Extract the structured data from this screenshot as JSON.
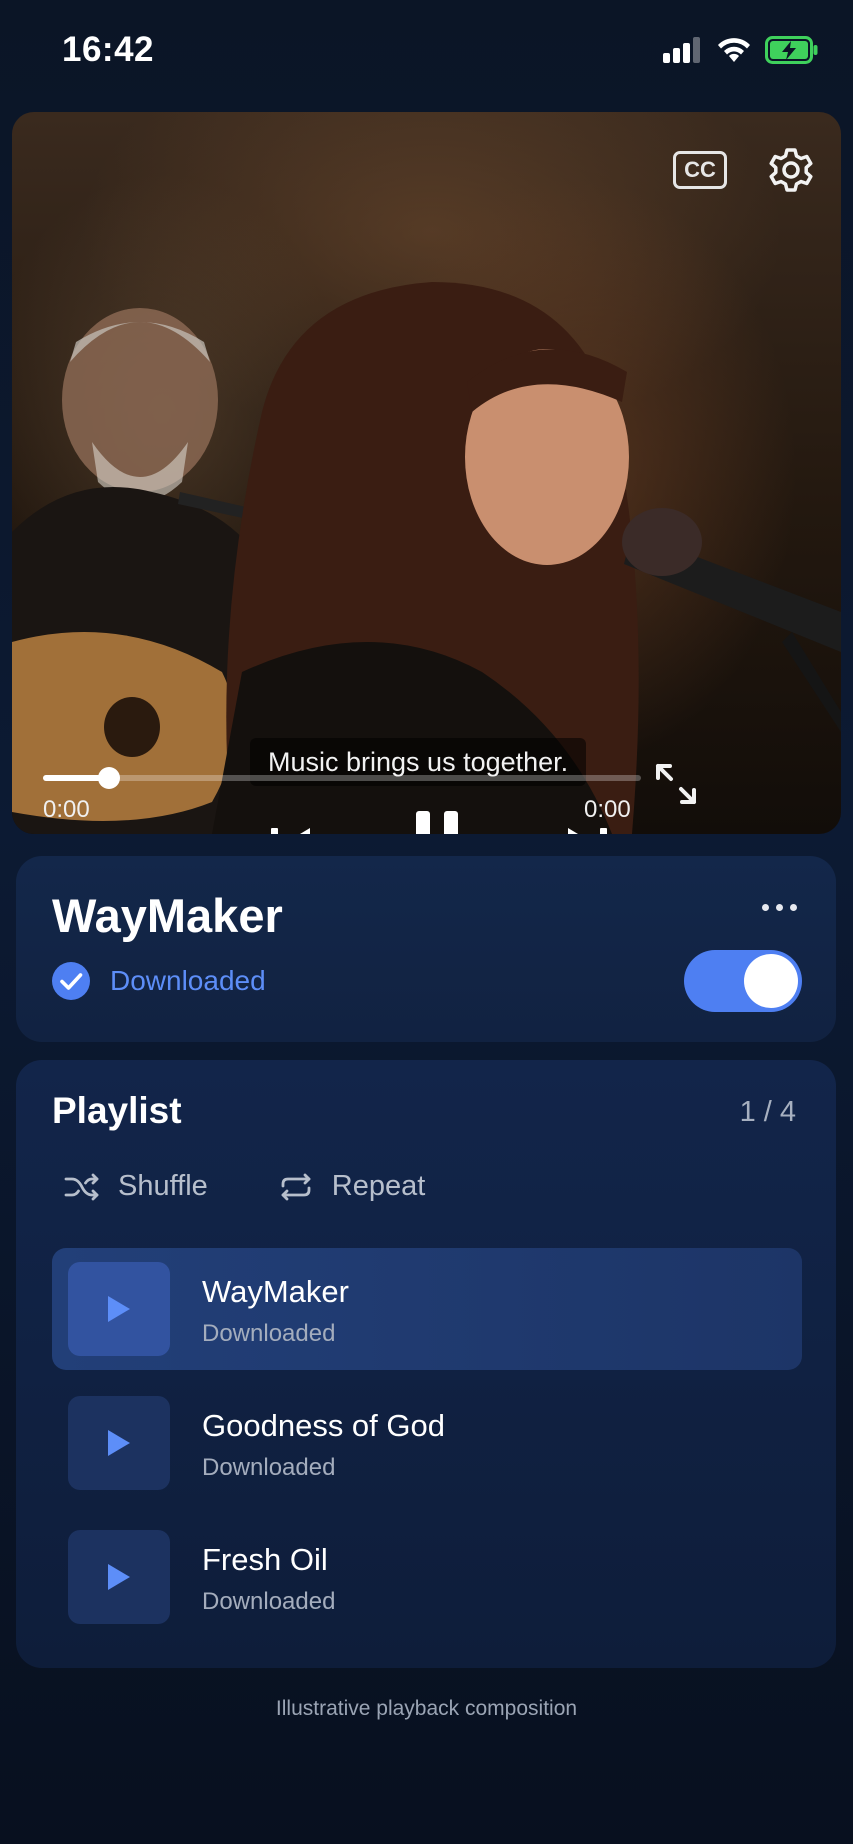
{
  "status_bar": {
    "time": "16:42",
    "icons": [
      "signal-icon",
      "wifi-icon",
      "battery-charging-icon"
    ]
  },
  "video": {
    "subtitle": "Music brings us together.",
    "cc_label": "CC",
    "current_time": "0:00",
    "total_time": "0:00",
    "progress": 0.11,
    "icons": [
      "cc-icon",
      "gear-icon",
      "skip-previous-icon",
      "pause-icon",
      "skip-next-icon",
      "fullscreen-icon"
    ]
  },
  "track": {
    "title": "WayMaker",
    "status": "Downloaded",
    "download_toggle_on": true
  },
  "playlist": {
    "title": "Playlist",
    "count": "1 / 4",
    "shuffle_label": "Shuffle",
    "repeat_label": "Repeat",
    "items": [
      {
        "name": "WayMaker",
        "status": "Downloaded",
        "active": true
      },
      {
        "name": "Goodness of God",
        "status": "Downloaded",
        "active": false
      },
      {
        "name": "Fresh Oil",
        "status": "Downloaded",
        "active": false
      }
    ]
  },
  "caption": "Illustrative playback composition",
  "colors": {
    "accent": "#4e7ff2",
    "downloaded_text": "#5d8ef8",
    "card_bg": "#13274a",
    "page_bg": "#0b1526"
  }
}
